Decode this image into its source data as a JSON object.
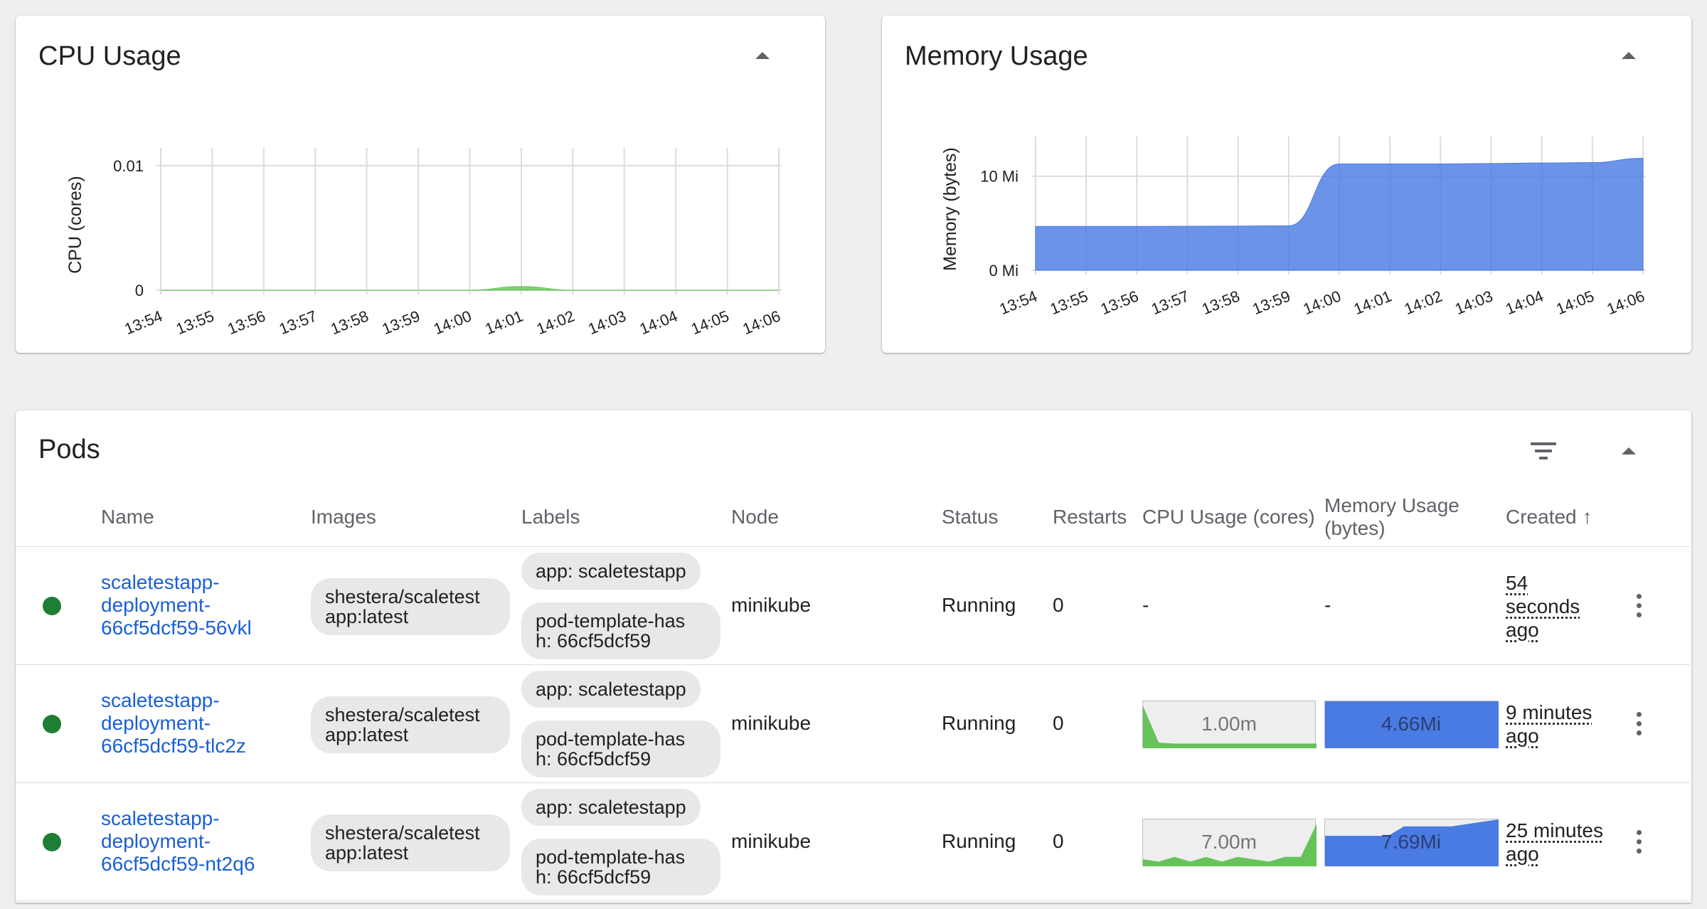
{
  "cpu_card": {
    "title": "CPU Usage",
    "chart_data": {
      "type": "area",
      "title": "CPU Usage",
      "ylabel": "CPU (cores)",
      "xlabel": "",
      "x": [
        "13:54",
        "13:55",
        "13:56",
        "13:57",
        "13:58",
        "13:59",
        "14:00",
        "14:01",
        "14:02",
        "14:03",
        "14:04",
        "14:05",
        "14:06"
      ],
      "y_ticks": [
        "0.01",
        "0"
      ],
      "ylim": [
        0,
        0.0105
      ],
      "grid": true,
      "series": [
        {
          "values": [
            0,
            0,
            0,
            0,
            0,
            0,
            0,
            0.0003,
            0,
            0,
            0,
            0,
            0
          ],
          "color": "#66c35a"
        }
      ]
    }
  },
  "memory_card": {
    "title": "Memory Usage",
    "chart_data": {
      "type": "area",
      "title": "Memory Usage",
      "ylabel": "Memory (bytes)",
      "xlabel": "",
      "x": [
        "13:54",
        "13:55",
        "13:56",
        "13:57",
        "13:58",
        "13:59",
        "14:00",
        "14:01",
        "14:02",
        "14:03",
        "14:04",
        "14:05",
        "14:06"
      ],
      "y_ticks": [
        "10 Mi",
        "0 Mi"
      ],
      "ylim": [
        0,
        13
      ],
      "grid": true,
      "series": [
        {
          "values": [
            4.66,
            4.66,
            4.66,
            4.68,
            4.7,
            4.72,
            11.3,
            11.3,
            11.3,
            11.35,
            11.4,
            11.45,
            11.9
          ],
          "color": "#4a7be3"
        }
      ]
    }
  },
  "pods": {
    "title": "Pods",
    "columns": {
      "name": "Name",
      "images": "Images",
      "labels": "Labels",
      "node": "Node",
      "status": "Status",
      "restarts": "Restarts",
      "cpu": "CPU Usage (cores)",
      "memory_line1": "Memory Usage",
      "memory_line2": "(bytes)",
      "created": "Created",
      "sort_arrow": "↑"
    },
    "rows": [
      {
        "name_lines": [
          "scaletestapp-",
          "deployment-",
          "66cf5dcf59-56vkl"
        ],
        "image_lines": [
          "shestera/scaletest",
          "app:latest"
        ],
        "label_1": "app: scaletestapp",
        "label_2_lines": [
          "pod-template-has",
          "h: 66cf5dcf59"
        ],
        "node": "minikube",
        "status": "Running",
        "restarts": "0",
        "cpu": "-",
        "memory": "-",
        "created_lines": [
          "54",
          "seconds",
          "ago"
        ],
        "status_color": "#1e7e34"
      },
      {
        "name_lines": [
          "scaletestapp-",
          "deployment-",
          "66cf5dcf59-tlc2z"
        ],
        "image_lines": [
          "shestera/scaletest",
          "app:latest"
        ],
        "label_1": "app: scaletestapp",
        "label_2_lines": [
          "pod-template-has",
          "h: 66cf5dcf59"
        ],
        "node": "minikube",
        "status": "Running",
        "restarts": "0",
        "cpu": "1.00m",
        "memory": "4.66Mi",
        "created_lines": [
          "9 minutes",
          "ago"
        ],
        "status_color": "#1e7e34",
        "cpu_spark": [
          9,
          1.2,
          1,
          1,
          1,
          1,
          1,
          1,
          1,
          1,
          1,
          1
        ],
        "mem_spark": [
          10,
          10,
          10,
          10,
          10,
          10,
          10,
          10,
          10,
          10,
          10,
          10
        ]
      },
      {
        "name_lines": [
          "scaletestapp-",
          "deployment-",
          "66cf5dcf59-nt2q6"
        ],
        "image_lines": [
          "shestera/scaletest",
          "app:latest"
        ],
        "label_1": "app: scaletestapp",
        "label_2_lines": [
          "pod-template-has",
          "h: 66cf5dcf59"
        ],
        "node": "minikube",
        "status": "Running",
        "restarts": "0",
        "cpu": "7.00m",
        "memory": "7.69Mi",
        "created_lines": [
          "25 minutes",
          "ago"
        ],
        "status_color": "#1e7e34",
        "cpu_spark": [
          1.5,
          1,
          2,
          1,
          2,
          1,
          2,
          1.5,
          1,
          2,
          2,
          9
        ],
        "mem_spark": [
          6.5,
          6.5,
          6.5,
          6.5,
          6.5,
          8.5,
          8.5,
          8.5,
          8.5,
          9,
          9.5,
          10
        ]
      }
    ]
  },
  "colors": {
    "cpu_fill": "#66c35a",
    "memory_fill": "#4a7be3",
    "link": "#1a5fd6",
    "status_running": "#1e7e34",
    "spark_bg": "#eeeeee"
  }
}
